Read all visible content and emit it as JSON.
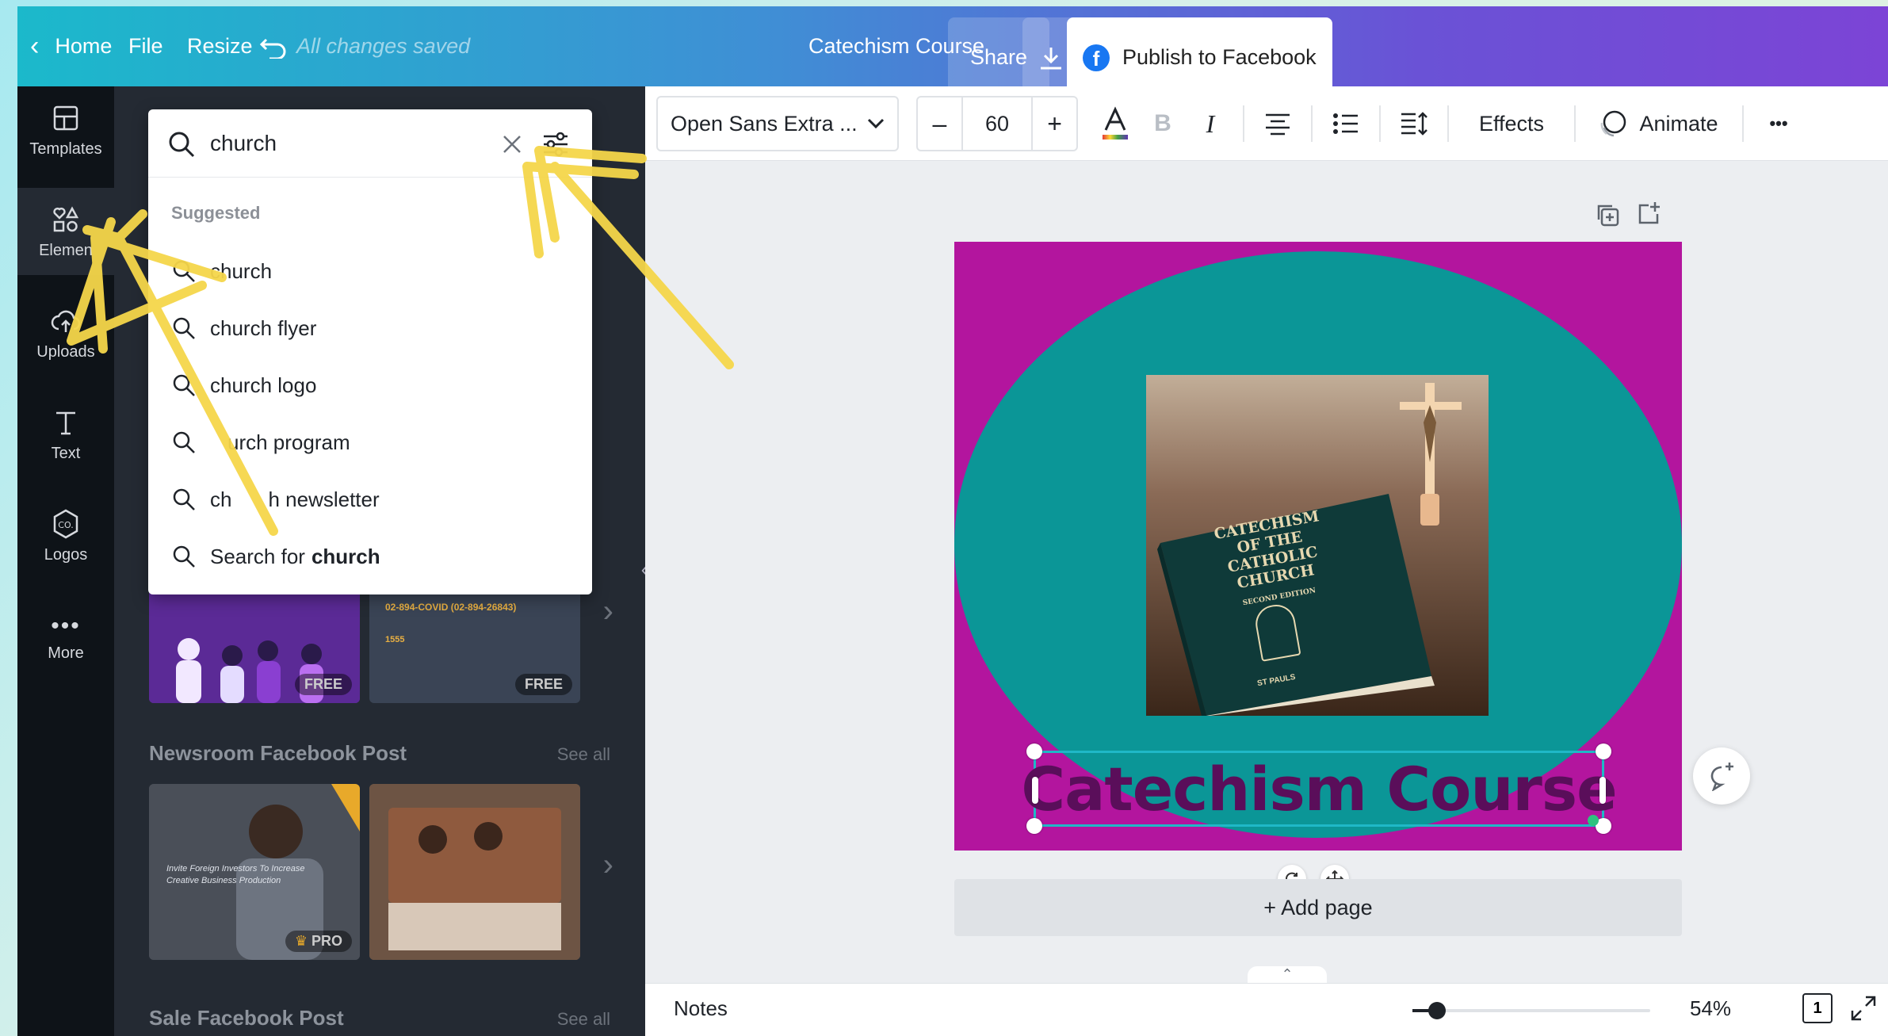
{
  "topbar": {
    "home": "Home",
    "file": "File",
    "resize": "Resize",
    "saved_status": "All changes saved",
    "design_name": "Catechism Course",
    "share": "Share",
    "publish": "Publish to Facebook"
  },
  "rail": {
    "templates": "Templates",
    "elements": "Elemen",
    "uploads": "Uploads",
    "text": "Text",
    "logos": "Logos",
    "more": "More"
  },
  "search": {
    "value": "church",
    "suggested_label": "Suggested",
    "suggestions": [
      "church",
      "church flyer",
      "church logo",
      "urch program",
      "ch"
    ],
    "newsletter_tail": "h newsletter",
    "search_for_prefix": "Search for",
    "search_for_term": "church"
  },
  "panel": {
    "badge_free": "FREE",
    "badge_free2": "FREE",
    "newsroom_title": "Newsroom Facebook Post",
    "see_all": "See all",
    "badge_pro": "PRO",
    "sale_title": "Sale Facebook Post",
    "see_all2": "See all",
    "covid_line": "02-894-COVID (02-894-26843)",
    "covid_num": "1555",
    "news_text": "Invite Foreign Investors To Increase Creative Business Production"
  },
  "toolbar": {
    "font": "Open Sans Extra ...",
    "minus": "–",
    "size": "60",
    "plus": "+",
    "bold": "B",
    "italic": "I",
    "effects": "Effects",
    "animate": "Animate",
    "more": "•••"
  },
  "canvas": {
    "title": "Catechism Course",
    "book_lines": [
      "CATECHISM",
      "OF THE",
      "CATHOLIC",
      "CHURCH"
    ],
    "book_edition": "SECOND EDITION",
    "book_publisher": "ST PAULS"
  },
  "workspace": {
    "add_page": "+ Add page",
    "notes": "Notes",
    "zoom": "54%",
    "page_count": "1"
  },
  "colors": {
    "canvas_bg": "#b3159e",
    "circle": "#0b9697",
    "title_text": "#5a0e5a",
    "selection": "#1fb8c7",
    "annotation_arrow": "#f5d64a"
  }
}
